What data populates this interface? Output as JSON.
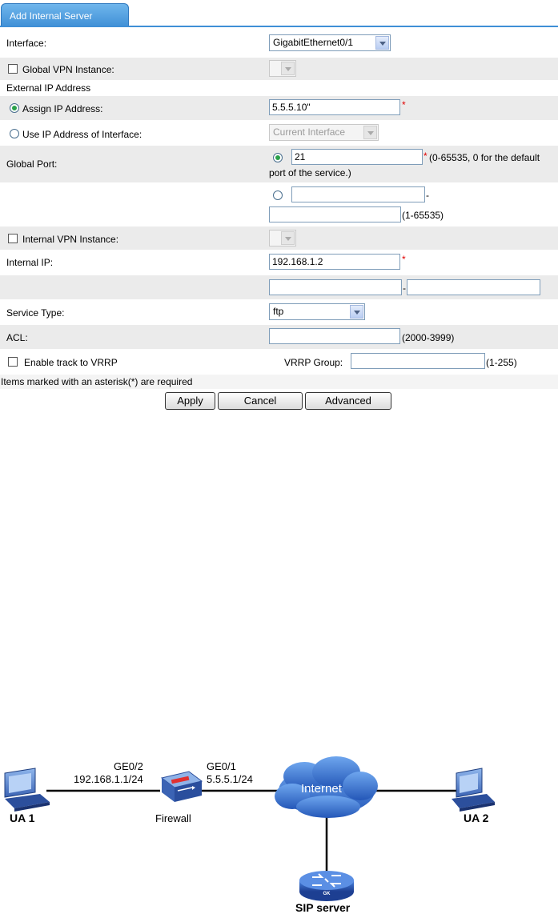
{
  "tab": {
    "label": "Add Internal Server"
  },
  "form": {
    "interface": {
      "label": "Interface:",
      "value": "GigabitEthernet0/1"
    },
    "global_vpn": {
      "label": "Global VPN Instance:",
      "value": ""
    },
    "external_ip": {
      "label": "External IP Address"
    },
    "assign_ip": {
      "label": "Assign IP Address:",
      "value": "5.5.5.10\""
    },
    "use_if_ip": {
      "label": "Use IP Address of Interface:",
      "value": "Current Interface"
    },
    "global_port": {
      "label": "Global Port:",
      "value": "21",
      "note": "(0-65535, 0 for the default",
      "note2": "port of the service.)"
    },
    "port_range": {
      "start": "",
      "end": "",
      "dash": "-",
      "note": "(1-65535)"
    },
    "internal_vpn": {
      "label": "Internal VPN Instance:",
      "value": ""
    },
    "internal_ip": {
      "label": "Internal IP:",
      "value": "192.168.1.2"
    },
    "internal_ip_range": {
      "start": "",
      "end": "",
      "dash": "-"
    },
    "service_type": {
      "label": "Service Type:",
      "value": "ftp"
    },
    "acl": {
      "label": "ACL:",
      "value": "",
      "note": "(2000-3999)"
    },
    "vrrp": {
      "label": "Enable track to VRRP",
      "group_label": "VRRP Group:",
      "group_value": "",
      "note": "(1-255)"
    },
    "required_note": "Items marked with an asterisk(*) are required",
    "asterisk": "*"
  },
  "buttons": {
    "apply": "Apply",
    "cancel": "Cancel",
    "advanced": "Advanced"
  },
  "diagram": {
    "ua1": "UA 1",
    "ge02": "GE0/2",
    "ge02_ip": "192.168.1.1/24",
    "firewall": "Firewall",
    "ge01": "GE0/1",
    "ge01_ip": "5.5.5.1/24",
    "internet": "Internet",
    "ua2": "UA 2",
    "sip_server": "SIP server",
    "router_badge": "GK"
  },
  "colors": {
    "tab": "#3f8fd6",
    "row_shade": "#ebebeb",
    "required": "#e00000",
    "radio_on": "#2aa14a",
    "cloud": "#2f6fd0",
    "router": "#2b5bb8"
  }
}
